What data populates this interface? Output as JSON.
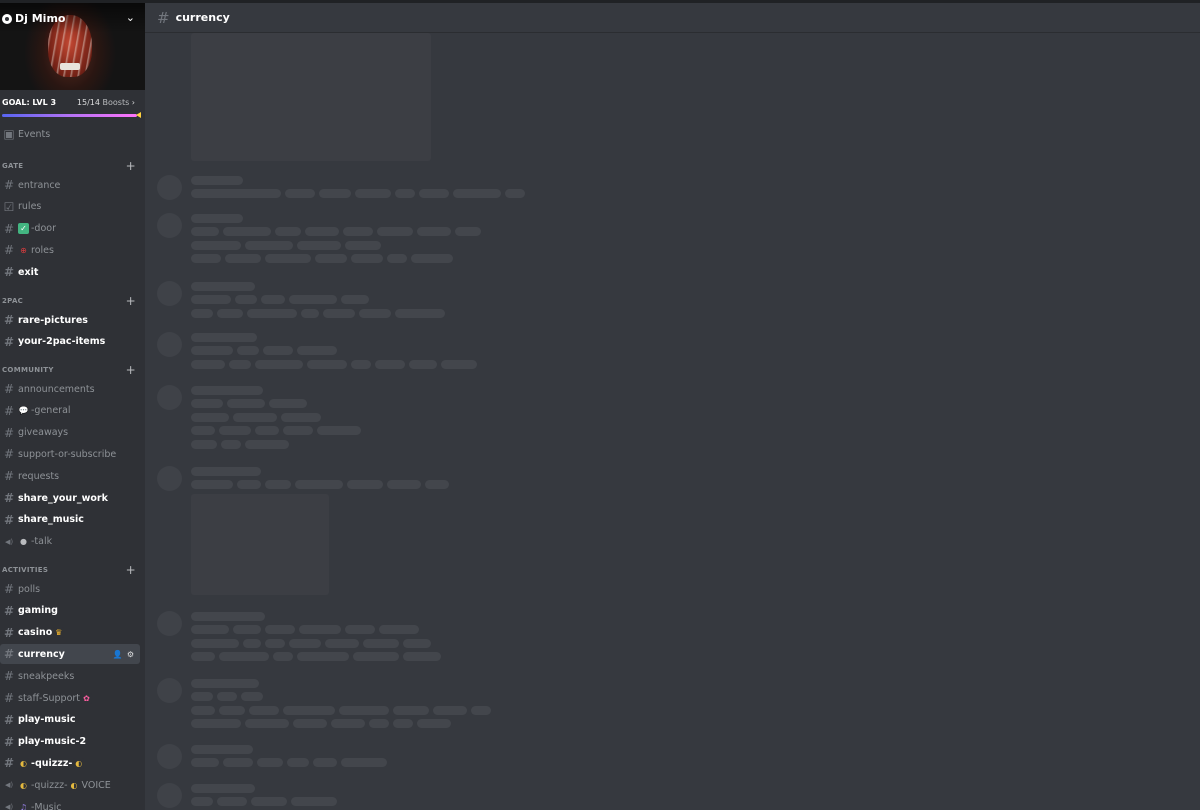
{
  "server": {
    "name": "Dj Mimo",
    "goal_label": "GOAL: LVL 3",
    "boosts_count": "15/14",
    "boosts_label": "Boosts",
    "boost_progress": 1.0
  },
  "events_label": "Events",
  "categories": [
    {
      "name": "GATE",
      "channels": [
        {
          "label": "entrance",
          "icon": "hash-icon",
          "state": "read"
        },
        {
          "label": "rules",
          "icon": "rules-checkbox-icon",
          "state": "read"
        },
        {
          "label": "-door",
          "icon": "hash-icon",
          "emoji": "check-mark-emoji",
          "state": "read"
        },
        {
          "label": "roles",
          "icon": "hash-icon",
          "emoji": "crosshair-emoji",
          "state": "read"
        },
        {
          "label": "exit",
          "icon": "hash-icon",
          "state": "unread"
        }
      ]
    },
    {
      "name": "2PAC",
      "channels": [
        {
          "label": "rare-pictures",
          "icon": "hash-icon",
          "state": "unread"
        },
        {
          "label": "your-2pac-items",
          "icon": "hash-icon",
          "state": "unread"
        }
      ]
    },
    {
      "name": "COMMUNITY",
      "channels": [
        {
          "label": "announcements",
          "icon": "hash-icon",
          "state": "read"
        },
        {
          "label": "-general",
          "icon": "hash-icon",
          "emoji": "speech-bubble-emoji",
          "state": "read"
        },
        {
          "label": "giveaways",
          "icon": "hash-icon",
          "state": "read"
        },
        {
          "label": "support-or-subscribe",
          "icon": "hash-icon",
          "state": "read"
        },
        {
          "label": "requests",
          "icon": "hash-icon",
          "state": "read"
        },
        {
          "label": "share_your_work",
          "icon": "hash-icon",
          "state": "unread"
        },
        {
          "label": "share_music",
          "icon": "hash-icon",
          "state": "unread"
        },
        {
          "label": "-talk",
          "icon": "speaker-icon",
          "emoji": "speaking-head-emoji",
          "state": "read"
        }
      ]
    },
    {
      "name": "ACTIVITIES",
      "channels": [
        {
          "label": "polls",
          "icon": "hash-icon",
          "state": "read"
        },
        {
          "label": "gaming",
          "icon": "hash-icon",
          "state": "unread"
        },
        {
          "label": "casino",
          "icon": "hash-icon",
          "emoji_after": "crown-emoji",
          "state": "unread"
        },
        {
          "label": "currency",
          "icon": "hash-icon",
          "state": "active"
        },
        {
          "label": "sneakpeeks",
          "icon": "hash-icon",
          "state": "read"
        },
        {
          "label": "staff-Support",
          "icon": "hash-icon",
          "emoji_after": "ribbon-emoji",
          "state": "read"
        },
        {
          "label": "play-music",
          "icon": "hash-icon",
          "state": "unread"
        },
        {
          "label": "play-music-2",
          "icon": "hash-icon",
          "state": "unread"
        },
        {
          "label": "-quizzz-",
          "icon": "hash-icon",
          "emoji": "theater-masks-emoji",
          "emoji_after": "theater-masks-emoji",
          "state": "unread"
        },
        {
          "label": "-quizzz-",
          "icon": "speaker-icon",
          "emoji": "theater-masks-emoji",
          "emoji_after": "theater-masks-emoji",
          "suffix": " VOICE",
          "state": "read"
        },
        {
          "label": "-Music",
          "icon": "speaker-icon",
          "emoji": "music-notes-emoji",
          "state": "read"
        }
      ]
    }
  ],
  "channel_header": {
    "name": "currency",
    "icon": "hash-icon"
  },
  "colors": {
    "sidebar": "#2f3136",
    "main": "#36393f",
    "active_row": "#42464d",
    "placeholder": "#43464c",
    "boost_bar": [
      "#5865f2",
      "#b473f5",
      "#ff73fa"
    ]
  }
}
